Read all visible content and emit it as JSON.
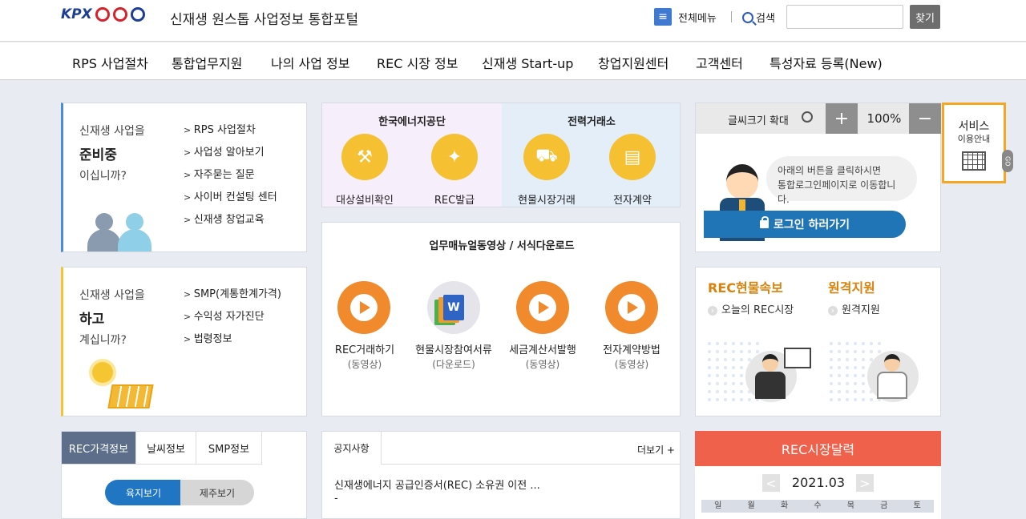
{
  "header": {
    "logo_text": "KPX",
    "portal_title": "신재생 원스톱 사업정보 통합포털",
    "all_menu_label": "전체메뉴",
    "search_label": "검색",
    "search_button": "찾기"
  },
  "gnb": {
    "items": [
      "RPS 사업절차",
      "통합업무지원",
      "나의 사업 정보",
      "REC 시장 정보",
      "신재생 Start-up",
      "창업지원센터",
      "고객센터",
      "특성자료 등록(New)"
    ]
  },
  "prepare_panel": {
    "line1": "신재생 사업을",
    "line2": "준비중",
    "line3": "이십니까?",
    "links": [
      "RPS 사업절차",
      "사업성 알아보기",
      "자주묻는 질문",
      "사이버 컨설팅 센터",
      "신재생 창업교육"
    ]
  },
  "doing_panel": {
    "line1": "신재생 사업을",
    "line2": "하고",
    "line3": "계십니까?",
    "links": [
      "SMP(계통한계가격)",
      "수익성 자가진단",
      "법령정보"
    ]
  },
  "agencies": {
    "left_title": "한국에너지공단",
    "right_title": "전력거래소",
    "items": [
      {
        "label": "대상설비확인",
        "icon": "wrench-monitor-icon"
      },
      {
        "label": "REC발급",
        "icon": "lightbulb-icon"
      },
      {
        "label": "현물시장거래",
        "icon": "cart-icon"
      },
      {
        "label": "전자계약",
        "icon": "document-chart-icon"
      }
    ]
  },
  "manuals": {
    "title": "업무매뉴얼동영상 / 서식다운로드",
    "items": [
      {
        "label": "REC거래하기",
        "sub": "(동영상)"
      },
      {
        "label": "현물시장참여서류",
        "sub": "(다운로드)"
      },
      {
        "label": "세금계산서발행",
        "sub": "(동영상)"
      },
      {
        "label": "전자계약방법",
        "sub": "(동영상)"
      }
    ]
  },
  "zoom": {
    "label": "글씨크기 확대",
    "plus": "+",
    "value": "100%",
    "minus": "−"
  },
  "login": {
    "bubble_line1": "아래의 버튼을 클릭하시면",
    "bubble_line2": "통합로그인페이지로 이동합니다.",
    "button": "로그인 하러가기"
  },
  "service_guide": {
    "line1": "서비스",
    "line2": "이용안내",
    "go": "GO"
  },
  "rec_quick": {
    "left_title": "REC현물속보",
    "left_link": "오늘의 REC시장",
    "right_title": "원격지원",
    "right_link": "원격지원"
  },
  "price_tabs": {
    "tabs": [
      "REC가격정보",
      "날씨정보",
      "SMP정보"
    ],
    "seg_on": "육지보기",
    "seg_off": "제주보기"
  },
  "notice": {
    "tab": "공지사항",
    "more": "더보기 +",
    "item": "신재생에너지 공급인증서(REC) 소유권 이전 ...",
    "item2": "-"
  },
  "calendar": {
    "title": "REC시장달력",
    "prev": "<",
    "next": ">",
    "month": "2021.03",
    "days": [
      "일",
      "월",
      "화",
      "수",
      "목",
      "금",
      "토"
    ]
  },
  "colors": {
    "accent_blue": "#4a8bdc",
    "accent_yellow": "#f3c432",
    "orange": "#f08a2d",
    "calendar_red": "#f0614b",
    "login_blue": "#1f75b6"
  }
}
